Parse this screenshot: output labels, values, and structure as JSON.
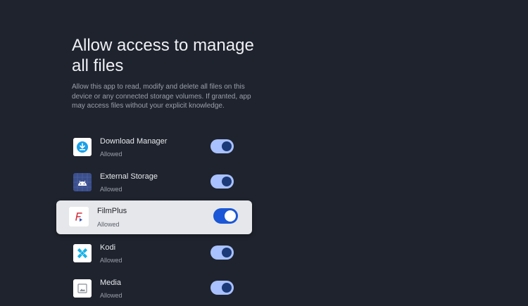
{
  "screen": {
    "title": "Allow access to manage all files",
    "description": "Allow this app to read, modify and delete all files on this device or any connected storage volumes. If granted, app may access files without your explicit knowledge."
  },
  "apps": [
    {
      "name": "Download Manager",
      "status": "Allowed",
      "enabled": true,
      "icon": "download-manager-icon"
    },
    {
      "name": "External Storage",
      "status": "Allowed",
      "enabled": true,
      "icon": "android-icon"
    },
    {
      "name": "FilmPlus",
      "status": "Allowed",
      "enabled": true,
      "icon": "filmplus-icon",
      "focused": true
    },
    {
      "name": "Kodi",
      "status": "Allowed",
      "enabled": true,
      "icon": "kodi-icon"
    },
    {
      "name": "Media",
      "status": "Allowed",
      "enabled": true,
      "icon": "media-icon"
    }
  ],
  "colors": {
    "background": "#1f232d",
    "toggle_on": "#a9c1ff",
    "toggle_focused": "#1b57d6",
    "focus_card": "#e6e7eb"
  }
}
